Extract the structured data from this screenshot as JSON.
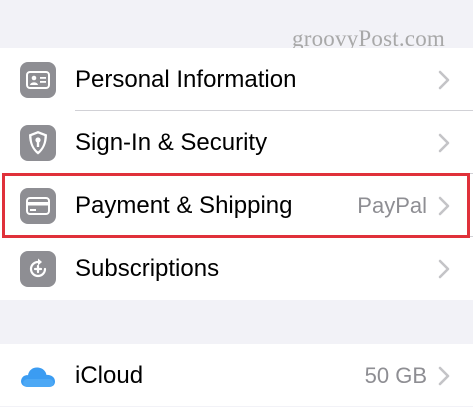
{
  "watermark": "groovyPost.com",
  "rows": [
    {
      "label": "Personal Information",
      "detail": "",
      "icon": "id-card-icon"
    },
    {
      "label": "Sign-In & Security",
      "detail": "",
      "icon": "shield-lock-icon"
    },
    {
      "label": "Payment & Shipping",
      "detail": "PayPal",
      "icon": "credit-card-icon"
    },
    {
      "label": "Subscriptions",
      "detail": "",
      "icon": "subscriptions-icon"
    }
  ],
  "icloud": {
    "label": "iCloud",
    "detail": "50 GB",
    "icon": "cloud-icon"
  },
  "colors": {
    "background": "#f2f2f7",
    "cell": "#ffffff",
    "icon_gray": "#8e8e93",
    "highlight": "#e0313a",
    "icloud_blue": "#3b9cf2"
  }
}
